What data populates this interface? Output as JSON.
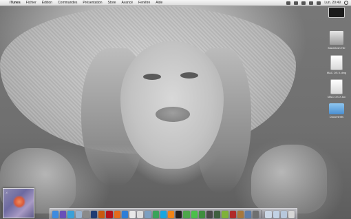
{
  "menubar": {
    "app_name": "iTunes",
    "items": [
      "Fichier",
      "Édition",
      "Commandes",
      "Présentation",
      "Store",
      "Avancé",
      "Fenêtre",
      "Aide"
    ],
    "clock": "Lun. 20:49"
  },
  "desktop_icons": [
    {
      "label": "",
      "icon": "monitor-icon"
    },
    {
      "label": "Macintosh HD",
      "icon": "hard-drive-icon"
    },
    {
      "label": "MAC OS X.dmg",
      "icon": "disk-image-icon"
    },
    {
      "label": "MAC OS X.iso",
      "icon": "disk-image-icon"
    },
    {
      "label": "Documents",
      "icon": "folder-icon"
    }
  ],
  "album_widget": {
    "logo": "♫"
  },
  "dock": {
    "items": [
      {
        "name": "finder",
        "color": "#3d8be0"
      },
      {
        "name": "itunes",
        "color": "#6a4fb8"
      },
      {
        "name": "safari",
        "color": "#3aa0d8"
      },
      {
        "name": "mail",
        "color": "#9ab3cf"
      },
      {
        "name": "system-preferences",
        "color": "#8a8a8a"
      },
      {
        "name": "photoshop",
        "color": "#1f3c73"
      },
      {
        "name": "illustrator",
        "color": "#c8590f"
      },
      {
        "name": "acrobat",
        "color": "#b3121c"
      },
      {
        "name": "firefox",
        "color": "#e46b1c"
      },
      {
        "name": "app-store",
        "color": "#2e7ed8"
      },
      {
        "name": "calendar",
        "color": "#e8e8e8"
      },
      {
        "name": "textedit",
        "color": "#dcdcdc"
      },
      {
        "name": "preview",
        "color": "#7c9fc0"
      },
      {
        "name": "chrome",
        "color": "#3aa35a"
      },
      {
        "name": "skype",
        "color": "#17a6e0"
      },
      {
        "name": "vlc",
        "color": "#f08418"
      },
      {
        "name": "terminal",
        "color": "#222222"
      },
      {
        "name": "activity-monitor",
        "color": "#4da64b"
      },
      {
        "name": "messages",
        "color": "#4cc04a"
      },
      {
        "name": "facetime",
        "color": "#3e8e3e"
      },
      {
        "name": "dashboard",
        "color": "#4a4a4a"
      },
      {
        "name": "time-machine",
        "color": "#3f5f3f"
      },
      {
        "name": "utorrent",
        "color": "#7fb239"
      },
      {
        "name": "photo-booth",
        "color": "#b02a2a"
      },
      {
        "name": "coffee",
        "color": "#a8783c"
      },
      {
        "name": "app-26",
        "color": "#5e7da8"
      },
      {
        "name": "app-27",
        "color": "#6f6f6f"
      }
    ],
    "stacks": [
      {
        "name": "applications-stack",
        "color": "#cbd7e6"
      },
      {
        "name": "documents-stack",
        "color": "#c1d1e4"
      },
      {
        "name": "downloads-stack",
        "color": "#b7c7db"
      },
      {
        "name": "trash",
        "color": "#d6d6d6"
      }
    ]
  }
}
